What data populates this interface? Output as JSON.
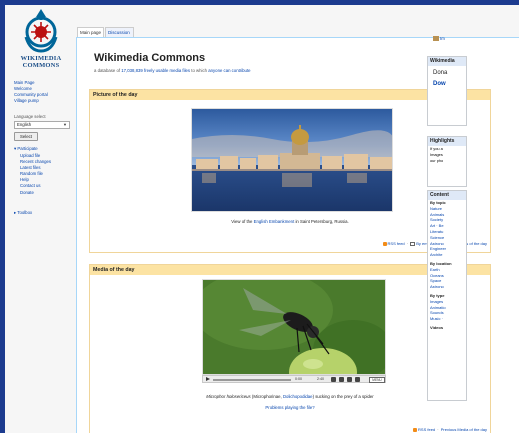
{
  "sidebar": {
    "logo_text": [
      "WIKIMEDIA",
      "COMMONS"
    ],
    "nav": [
      "Main Page",
      "Welcome",
      "Community portal",
      "Village pump"
    ],
    "language_label": "Language select",
    "language_value": "English",
    "select_button": "Select",
    "participate_heading": "Participate",
    "participate_items": [
      "Upload file",
      "Recent changes",
      "Latest files",
      "Random file",
      "Help",
      "Contact us",
      "Donate"
    ],
    "toolbox_heading": "Toolbox"
  },
  "tabs": [
    "Main page",
    "Discussion"
  ],
  "page": {
    "title": "Wikimedia Commons",
    "tagline_prefix": "a database of",
    "file_count": "17,038,839",
    "tagline_middle": "freely usable media files",
    "tagline_suffix": "to which",
    "tagline_link": "anyone can contribute"
  },
  "potd": {
    "heading": "Picture of the day",
    "caption_prefix": "View of the",
    "caption_link": "English Embankment",
    "caption_suffix": "in Saint Petersburg, Russia.",
    "rss": "RSS feed",
    "email": "By email",
    "previous": "Previous Pictures of the day"
  },
  "motd": {
    "heading": "Media of the day",
    "player_elapsed": "0:00",
    "player_total": "2:40",
    "player_menu": "MENU",
    "caption_species": "Microphor holosericeus",
    "caption_family_prefix": "(Microphorinae,",
    "caption_family_link": "Dolichopodidae",
    "caption_suffix": ") sucking on the prey of a spider",
    "problems": "Problems playing the file?",
    "rss": "RSS feed",
    "previous": "Previous Media of the day"
  },
  "right": {
    "upload_label": "Im",
    "box1_head": "Wikimedia",
    "box1_line1": "Dona",
    "box1_line2": "Dow",
    "box2_head": "Highlights",
    "box2_lines": [
      "If you a",
      "Images",
      "our pho"
    ],
    "box3_head": "Content",
    "content_items": [
      {
        "text": "By topic",
        "kind": "ch"
      },
      {
        "text": "Nature",
        "kind": "cl"
      },
      {
        "text": "Animals",
        "kind": "csub"
      },
      {
        "text": "Society",
        "kind": "cl"
      },
      {
        "text": "Art · Be",
        "kind": "csub"
      },
      {
        "text": "Literatu",
        "kind": "csub"
      },
      {
        "text": "Science",
        "kind": "cl"
      },
      {
        "text": "Astrono",
        "kind": "csub"
      },
      {
        "text": "Engineer",
        "kind": "cl"
      },
      {
        "text": "Archite",
        "kind": "csub"
      },
      {
        "text": "By location",
        "kind": "ch"
      },
      {
        "text": "Earth",
        "kind": "cl"
      },
      {
        "text": "Oceans",
        "kind": "csub"
      },
      {
        "text": "Space",
        "kind": "cl"
      },
      {
        "text": "Astrono",
        "kind": "csub"
      },
      {
        "text": "By type",
        "kind": "ch"
      },
      {
        "text": "Images",
        "kind": "cl"
      },
      {
        "text": "Animatio",
        "kind": "csub"
      },
      {
        "text": "Sounds",
        "kind": "cl"
      },
      {
        "text": "Music ·",
        "kind": "csub"
      },
      {
        "text": "Videos",
        "kind": "ch"
      }
    ]
  },
  "colors": {
    "link": "#0645ad",
    "box_header": "#fce3a3",
    "outer_background": "#1c3b8f"
  }
}
